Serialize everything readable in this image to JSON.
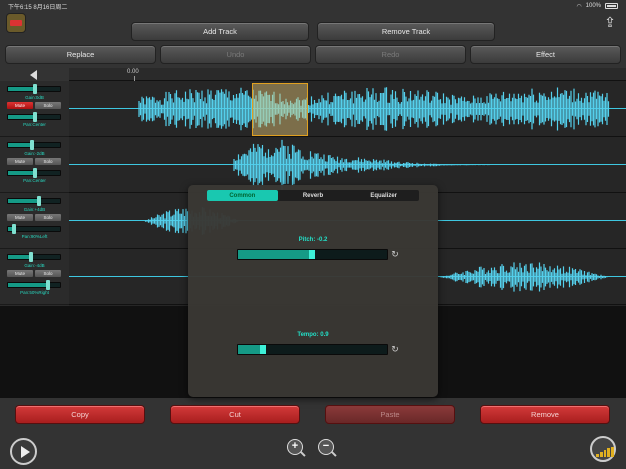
{
  "status": {
    "time": "下午6:15",
    "date": "8月16日周二",
    "battery": "100%"
  },
  "toolbar": {
    "add_track": "Add Track",
    "remove_track": "Remove Track",
    "replace": "Replace",
    "undo": "Undo",
    "redo": "Redo",
    "effect": "Effect"
  },
  "ruler": {
    "start": "0.00"
  },
  "tracks": [
    {
      "gain": "Gain:0dB",
      "pan": "Pan:Center",
      "mute": "Mute",
      "solo": "Solo",
      "mute_on": true
    },
    {
      "gain": "Gain:-2dB",
      "pan": "Pan:Center",
      "mute": "Mute",
      "solo": "Solo",
      "mute_on": false
    },
    {
      "gain": "Gain:+4dB",
      "pan": "Pan:90%Left",
      "mute": "Mute",
      "solo": "Solo",
      "mute_on": false
    },
    {
      "gain": "Gain:-4dB",
      "pan": "Pan:50%Right",
      "mute": "Mute",
      "solo": "Solo",
      "mute_on": false
    }
  ],
  "dialog": {
    "tabs": [
      "Common",
      "Reverb",
      "Equalizer"
    ],
    "active_tab": "Common",
    "pitch_label": "Pitch: -0.2",
    "pitch_fraction": 0.5,
    "tempo_label": "Tempo: 0.9",
    "tempo_fraction": 0.17
  },
  "edit": {
    "copy": "Copy",
    "cut": "Cut",
    "paste": "Paste",
    "remove": "Remove"
  },
  "colors": {
    "accent": "#19c8b0",
    "wave": "#55d0ec",
    "danger": "#c32a2a"
  }
}
